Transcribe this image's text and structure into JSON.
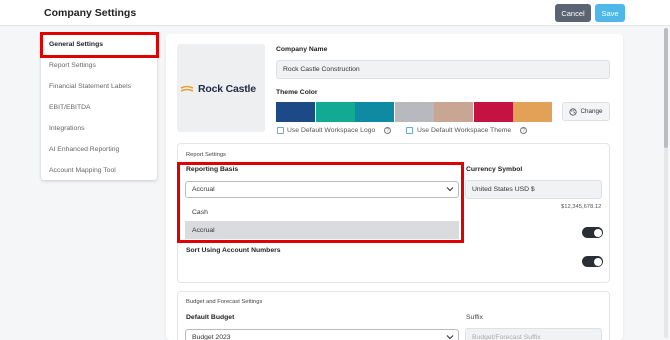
{
  "header": {
    "title": "Company Settings",
    "cancel_label": "Cancel",
    "save_label": "Save"
  },
  "sidebar": {
    "items": [
      {
        "label": "General Settings",
        "active": true
      },
      {
        "label": "Report Settings",
        "active": false
      },
      {
        "label": "Financial Statement Labels",
        "active": false
      },
      {
        "label": "EBIT/EBITDA",
        "active": false
      },
      {
        "label": "Integrations",
        "active": false
      },
      {
        "label": "AI Enhanced Reporting",
        "active": false
      },
      {
        "label": "Account Mapping Tool",
        "active": false
      }
    ]
  },
  "company": {
    "logo_text": "Rock Castle",
    "name_label": "Company Name",
    "name_value": "Rock Castle Construction",
    "theme_label": "Theme Color",
    "theme_colors": [
      "#1b4a87",
      "#12aa93",
      "#0f8aa3",
      "#b8b9bf",
      "#c9a593",
      "#c41243",
      "#e3a057"
    ],
    "change_label": "Change",
    "use_default_logo_label": "Use Default Workspace Logo",
    "use_default_theme_label": "Use Default Workspace Theme"
  },
  "report_settings": {
    "section_title": "Report Settings",
    "reporting_basis_label": "Reporting Basis",
    "reporting_basis_value": "Accrual",
    "reporting_basis_options": [
      "Cash",
      "Accrual"
    ],
    "currency_label": "Currency Symbol",
    "currency_value": "United States USD $",
    "currency_example": "$12,345,678.12",
    "sort_label": "Sort Using Account Numbers"
  },
  "budget_settings": {
    "section_title": "Budget and Forecast Settings",
    "default_budget_label": "Default Budget",
    "default_budget_value": "Budget 2023",
    "suffix_label": "Suffix",
    "suffix_placeholder": "Budget/Forecast Suffix"
  },
  "colors": {
    "accent": "#4fb8e8",
    "highlight": "#e00000",
    "toggle_on": "#2b2f35"
  }
}
